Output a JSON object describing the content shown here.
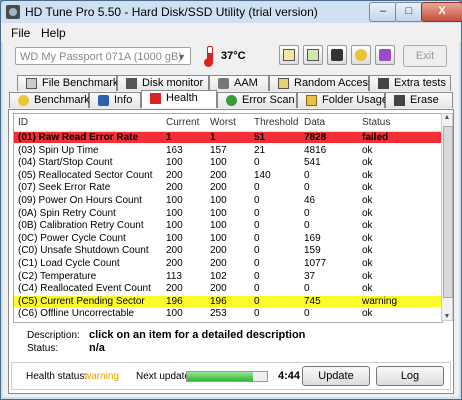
{
  "window": {
    "title": "HD Tune Pro 5.50 - Hard Disk/SSD Utility (trial version)",
    "min_label": "–",
    "max_label": "□",
    "close_label": "X"
  },
  "menu": {
    "file": "File",
    "help": "Help"
  },
  "toolbar": {
    "drive": "WD    My Passport 071A (1000 gB)",
    "temperature": "37°C",
    "exit_label": "Exit"
  },
  "tabs_top": [
    {
      "label": "File Benchmark",
      "icon": "file-benchmark-icon"
    },
    {
      "label": "Disk monitor",
      "icon": "disk-monitor-icon"
    },
    {
      "label": "AAM",
      "icon": "aam-speaker-icon"
    },
    {
      "label": "Random Access",
      "icon": "random-access-icon"
    },
    {
      "label": "Extra tests",
      "icon": "extra-tests-icon"
    }
  ],
  "tabs_bottom": [
    {
      "label": "Benchmark",
      "icon": "benchmark-icon"
    },
    {
      "label": "Info",
      "icon": "info-icon"
    },
    {
      "label": "Health",
      "icon": "health-cross-icon",
      "active": true
    },
    {
      "label": "Error Scan",
      "icon": "error-scan-icon"
    },
    {
      "label": "Folder Usage",
      "icon": "folder-icon"
    },
    {
      "label": "Erase",
      "icon": "erase-icon"
    }
  ],
  "table": {
    "columns": [
      "ID",
      "Current",
      "Worst",
      "Threshold",
      "Data",
      "Status"
    ],
    "rows": [
      {
        "id": "(01) Raw Read Error Rate",
        "current": "1",
        "worst": "1",
        "threshold": "51",
        "data": "7828",
        "status": "failed",
        "style": "failed"
      },
      {
        "id": "(03) Spin Up Time",
        "current": "163",
        "worst": "157",
        "threshold": "21",
        "data": "4816",
        "status": "ok"
      },
      {
        "id": "(04) Start/Stop Count",
        "current": "100",
        "worst": "100",
        "threshold": "0",
        "data": "541",
        "status": "ok"
      },
      {
        "id": "(05) Reallocated Sector Count",
        "current": "200",
        "worst": "200",
        "threshold": "140",
        "data": "0",
        "status": "ok"
      },
      {
        "id": "(07) Seek Error Rate",
        "current": "200",
        "worst": "200",
        "threshold": "0",
        "data": "0",
        "status": "ok"
      },
      {
        "id": "(09) Power On Hours Count",
        "current": "100",
        "worst": "100",
        "threshold": "0",
        "data": "46",
        "status": "ok"
      },
      {
        "id": "(0A) Spin Retry Count",
        "current": "100",
        "worst": "100",
        "threshold": "0",
        "data": "0",
        "status": "ok"
      },
      {
        "id": "(0B) Calibration Retry Count",
        "current": "100",
        "worst": "100",
        "threshold": "0",
        "data": "0",
        "status": "ok"
      },
      {
        "id": "(0C) Power Cycle Count",
        "current": "100",
        "worst": "100",
        "threshold": "0",
        "data": "169",
        "status": "ok"
      },
      {
        "id": "(C0) Unsafe Shutdown Count",
        "current": "200",
        "worst": "200",
        "threshold": "0",
        "data": "159",
        "status": "ok"
      },
      {
        "id": "(C1) Load Cycle Count",
        "current": "200",
        "worst": "200",
        "threshold": "0",
        "data": "1077",
        "status": "ok"
      },
      {
        "id": "(C2) Temperature",
        "current": "113",
        "worst": "102",
        "threshold": "0",
        "data": "37",
        "status": "ok"
      },
      {
        "id": "(C4) Reallocated Event Count",
        "current": "200",
        "worst": "200",
        "threshold": "0",
        "data": "0",
        "status": "ok"
      },
      {
        "id": "(C5) Current Pending Sector",
        "current": "196",
        "worst": "196",
        "threshold": "0",
        "data": "745",
        "status": "warning",
        "style": "warn"
      },
      {
        "id": "(C6) Offline Uncorrectable",
        "current": "100",
        "worst": "253",
        "threshold": "0",
        "data": "0",
        "status": "ok"
      }
    ]
  },
  "description": {
    "label": "Description:",
    "value": "click on an item for a detailed description",
    "status_label": "Status:",
    "status_value": "n/a"
  },
  "footer": {
    "health_label": "Health status:",
    "health_value": "warning",
    "next_update_label": "Next update:",
    "next_update_progress": 0.82,
    "next_update_time": "4:44",
    "update_button": "Update",
    "log_button": "Log"
  },
  "colors": {
    "failed_row": "#f32e36",
    "warning_row": "#fcfa2b",
    "warning_text": "#e6a000"
  }
}
